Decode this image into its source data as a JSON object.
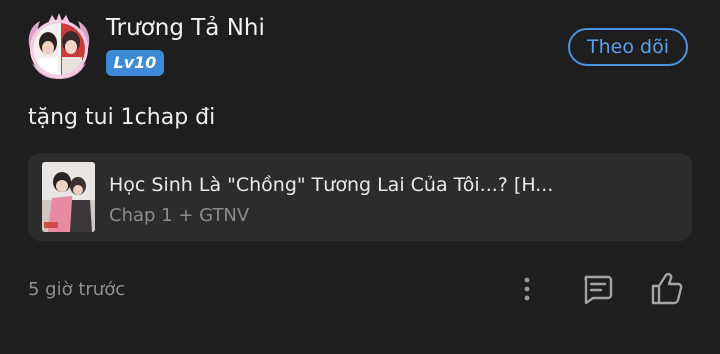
{
  "user": {
    "name": "Trương Tả Nhi",
    "level": "Lv10",
    "follow_label": "Theo dõi"
  },
  "comment": {
    "text": "tặng tui 1chap đi",
    "timestamp": "5 giờ trước"
  },
  "chapter_card": {
    "title": "Học Sinh Là \"Chồng\" Tương Lai Của Tôi...? [H...",
    "subtitle": "Chap 1 + GTNV"
  },
  "icons": {
    "more": "more-vertical-icon",
    "reply": "comment-icon",
    "like": "thumbs-up-icon"
  },
  "colors": {
    "background": "#1e1e1f",
    "card": "#2c2c2d",
    "accent": "#4a93e0",
    "level_badge": "#3f8ad8",
    "muted_text": "#8e8e8e"
  }
}
